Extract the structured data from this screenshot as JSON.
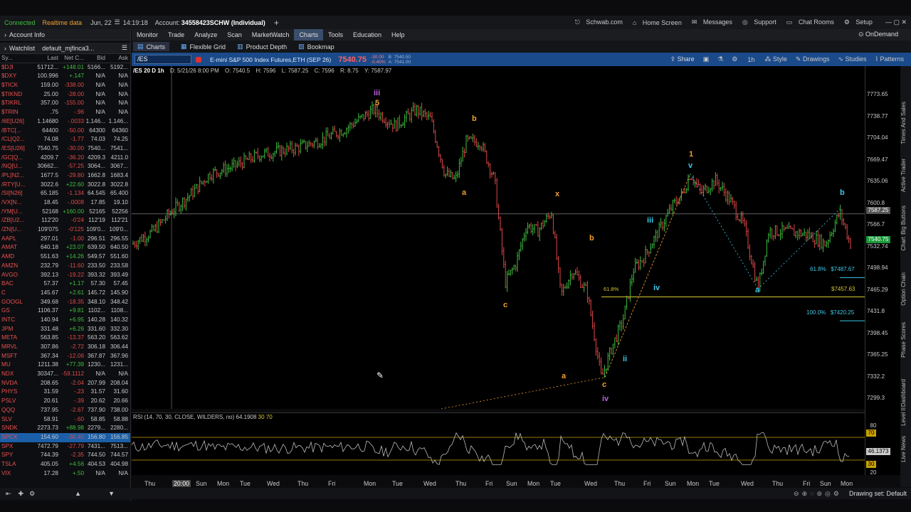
{
  "topbar": {
    "connected": "Connected",
    "realtime": "Realtime data",
    "date": "Jun, 22",
    "time": "14:19:18",
    "account_label": "Account:",
    "account": "34558423SCHW (Individual)",
    "schwab": "Schwab.com",
    "home": "Home Screen",
    "messages": "Messages",
    "support": "Support",
    "chat": "Chat Rooms",
    "setup": "Setup",
    "ondemand": "OnDemand"
  },
  "left": {
    "account_info": "Account Info",
    "watchlist": "Watchlist",
    "watchlist_name": "default_mjfinca3...",
    "cols": [
      "Sy...",
      "Last",
      "Net C...",
      "Bid",
      "Ask"
    ]
  },
  "watchlist": [
    [
      "$DJI",
      "51712...",
      "+148.01",
      "5166...",
      "5192...",
      "g"
    ],
    [
      "$DXY",
      "100.996",
      "+.147",
      "N/A",
      "N/A",
      "g"
    ],
    [
      "$TICK",
      "159.00",
      "-338.00",
      "N/A",
      "N/A",
      "r"
    ],
    [
      "$TIKND",
      "25.00",
      "-28.00",
      "N/A",
      "N/A",
      "r"
    ],
    [
      "$TIKRL",
      "357.00",
      "-155.00",
      "N/A",
      "N/A",
      "r"
    ],
    [
      "$TRIN",
      ".75",
      "-.96",
      "N/A",
      "N/A",
      "r"
    ],
    [
      "/6E[U26]",
      "1.14680",
      "-.0033",
      "1.146...",
      "1.146...",
      "r"
    ],
    [
      "/BTC[...",
      "64400",
      "-50.00",
      "64300",
      "64360",
      "r"
    ],
    [
      "/CL[Q2...",
      "74.08",
      "-1.77",
      "74.03",
      "74.25",
      "r"
    ],
    [
      "/ES[U26]",
      "7540.75",
      "-30.00",
      "7540...",
      "7541...",
      "r"
    ],
    [
      "/GC[Q...",
      "4209.7",
      "-36.20",
      "4209.3",
      "4211.0",
      "r"
    ],
    [
      "/NQ[U...",
      "30662...",
      "-57.25",
      "3064...",
      "3067...",
      "r"
    ],
    [
      "/PL[N2...",
      "1677.5",
      "-29.80",
      "1662.8",
      "1683.4",
      "r"
    ],
    [
      "/RTY[U...",
      "3022.6",
      "+22.60",
      "3022.8",
      "3022.8",
      "g"
    ],
    [
      "/SI[N26]",
      "65.185",
      "-1.134",
      "64.545",
      "65.400",
      "r"
    ],
    [
      "/VX[N...",
      "18.45",
      "-.0008",
      "17.85",
      "19.10",
      "r"
    ],
    [
      "/YM[U...",
      "52168",
      "+160.00",
      "52165",
      "52256",
      "g"
    ],
    [
      "/ZB[U2...",
      "112'20",
      "-0'24",
      "112'19",
      "112'21",
      "r"
    ],
    [
      "/ZN[U...",
      "109'075",
      "-0'125",
      "109'0...",
      "109'0...",
      "r"
    ],
    [
      "AAPL",
      "297.01",
      "-1.00",
      "296.51",
      "296.55",
      "r"
    ],
    [
      "AMAT",
      "640.18",
      "+23.07",
      "639.50",
      "640.50",
      "g"
    ],
    [
      "AMD",
      "551.63",
      "+14.26",
      "549.57",
      "551.60",
      "g"
    ],
    [
      "AMZN",
      "232.79",
      "-11.60",
      "233.50",
      "233.58",
      "r"
    ],
    [
      "AVGO",
      "392.13",
      "-19.22",
      "393.32",
      "393.49",
      "r"
    ],
    [
      "BAC",
      "57.37",
      "+1.17",
      "57.30",
      "57.45",
      "g"
    ],
    [
      "C",
      "145.67",
      "+2.61",
      "145.72",
      "145.90",
      "g"
    ],
    [
      "GOOGL",
      "349.68",
      "-18.35",
      "348.10",
      "348.42",
      "r"
    ],
    [
      "GS",
      "1106.37",
      "+9.81",
      "1102...",
      "1108...",
      "g"
    ],
    [
      "INTC",
      "140.94",
      "+6.95",
      "140.28",
      "140.32",
      "g"
    ],
    [
      "JPM",
      "331.48",
      "+6.26",
      "331.60",
      "332.30",
      "g"
    ],
    [
      "META",
      "563.85",
      "-13.37",
      "563.20",
      "563.62",
      "r"
    ],
    [
      "MRVL",
      "307.86",
      "-2.72",
      "306.18",
      "306.44",
      "r"
    ],
    [
      "MSFT",
      "367.34",
      "-12.06",
      "367.87",
      "367.96",
      "r"
    ],
    [
      "MU",
      "1211.38",
      "+77.39",
      "1230...",
      "1231...",
      "g"
    ],
    [
      "NDX",
      "30347...",
      "-59.1112",
      "N/A",
      "N/A",
      "r"
    ],
    [
      "NVDA",
      "208.65",
      "-2.04",
      "207.99",
      "208.04",
      "r"
    ],
    [
      "PHYS",
      "31.59",
      "-.23",
      "31.57",
      "31.60",
      "r"
    ],
    [
      "PSLV",
      "20.61",
      "-.39",
      "20.62",
      "20.66",
      "r"
    ],
    [
      "QQQ",
      "737.95",
      "-2.67",
      "737.90",
      "738.00",
      "r"
    ],
    [
      "SLV",
      "58.91",
      "-.60",
      "58.85",
      "58.88",
      "r"
    ],
    [
      "SNDK",
      "2273.73",
      "+88.98",
      "2279...",
      "2280...",
      "g"
    ],
    [
      "SPCX",
      "154.60",
      "-30.40",
      "156.80",
      "156.85",
      "r"
    ],
    [
      "SPX",
      "7472.79",
      "-27.79",
      "7431...",
      "7513...",
      "r"
    ],
    [
      "SPY",
      "744.39",
      "-2.35",
      "744.50",
      "744.57",
      "r"
    ],
    [
      "TSLA",
      "405.05",
      "+4.56",
      "404.53",
      "404.98",
      "g"
    ],
    [
      "VIX",
      "17.28",
      "+.50",
      "N/A",
      "N/A",
      "g"
    ]
  ],
  "menu": [
    "Monitor",
    "Trade",
    "Analyze",
    "Scan",
    "MarketWatch",
    "Charts",
    "Tools",
    "Education",
    "Help"
  ],
  "subtabs": [
    "Charts",
    "Flexible Grid",
    "Product Depth",
    "Bookmap"
  ],
  "symbol": {
    "ticker": "/ES",
    "desc": "E-mini S&P 500 Index Futures,ETH (SEP 26)",
    "price": "7540.75",
    "change": "-30.00",
    "pct": "-0.40%",
    "bid": "B: 7540.50",
    "ask": "A: 7541.00",
    "share": "Share",
    "tf": "1h",
    "style": "Style",
    "drawings": "Drawings",
    "studies": "Studies",
    "patterns": "Patterns"
  },
  "ohlc": {
    "label": "/ES 20 D 1h",
    "date": "D: 5/21/26 8:00 PM",
    "o": "O: 7540.5",
    "h": "H: 7596",
    "l": "L: 7587.25",
    "c": "C: 7596",
    "r": "R: 8.75",
    "y": "Y: 7587.97"
  },
  "yaxis": [
    "7773.65",
    "7738.77",
    "7704.04",
    "7669.47",
    "7635.06",
    "7600.8",
    "7566.7",
    "7532.74",
    "7498.94",
    "7465.29",
    "7431.8",
    "7398.45",
    "7365.25",
    "7332.2",
    "7299.3"
  ],
  "price_tags": {
    "crosshair": "7587.25",
    "last": "7540.75",
    "last2": "7532.74"
  },
  "fib": {
    "f618a": "61.8%",
    "v618a": "$7487.67",
    "f618b": "61.8%",
    "v618b": "$7457.63",
    "f100": "100.0%",
    "v100": "$7420.25"
  },
  "waves": {
    "iii_top": "iii",
    "five": "5",
    "b1": "b",
    "a1": "a",
    "c1": "c",
    "x": "x",
    "a2": "a",
    "b2": "b",
    "c2": "c",
    "iv_purple": "iv",
    "iii_cyan": "iii",
    "ii_cyan": "ii",
    "iv_cyan": "iv",
    "one": "1",
    "v": "v",
    "a3": "a",
    "b3": "b"
  },
  "rsi": {
    "label": "RSI (14, 70, 30, CLOSE, WILDERS, no)",
    "value": "64.1908",
    "ob": "30",
    "os": "70",
    "v80": "80",
    "v70": "70",
    "vcur": "46.1373",
    "v30": "30",
    "v20": "20"
  },
  "xaxis": [
    "Thu",
    "20:00",
    "Sun",
    "Mon",
    "Tue",
    "Wed",
    "Thu",
    "Fri",
    "Mon",
    "Tue",
    "Wed",
    "Thu",
    "Fri",
    "Sun",
    "Mon",
    "Tue",
    "Wed",
    "Thu",
    "Fri",
    "Sun",
    "Mon",
    "Tue",
    "Wed",
    "Thu",
    "Fri",
    "Sun",
    "Mon"
  ],
  "rtabs": [
    "Times And Sales",
    "Active Trader",
    "Big Buttons",
    "Chart",
    "Option Chain",
    "Phase Scores",
    "Dashboard",
    "Level II",
    "Live News"
  ],
  "status": {
    "drawing_set": "Drawing set: Default"
  },
  "colors": {
    "up": "#3fbf3f",
    "down": "#e04848",
    "wave_orange": "#f0a030",
    "wave_cyan": "#3ec8e8",
    "wave_purple": "#c060e0",
    "fib_yellow": "#d8c838"
  }
}
